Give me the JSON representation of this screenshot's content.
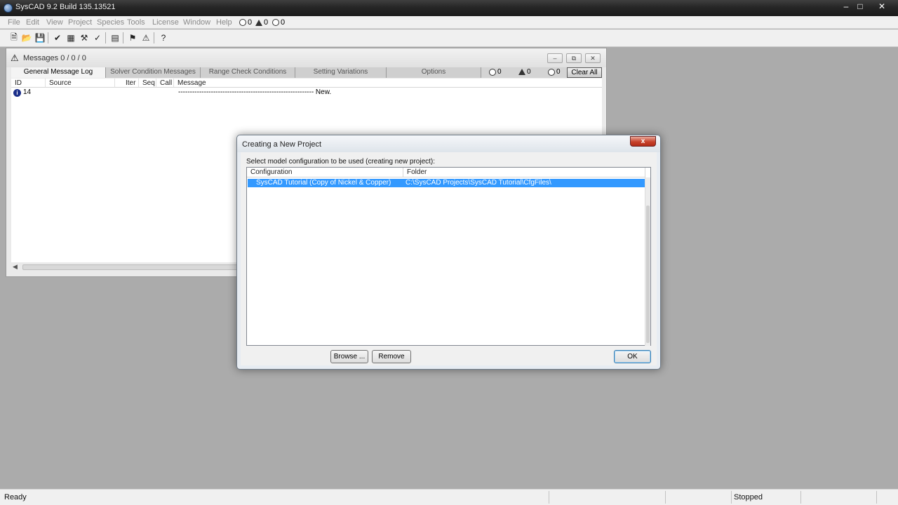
{
  "app": {
    "title": "SysCAD 9.2 Build 135.13521"
  },
  "menu": {
    "items": [
      "File",
      "Edit",
      "View",
      "Project",
      "Species",
      "Tools",
      "License",
      "Window",
      "Help"
    ],
    "counters": [
      "0",
      "0",
      "0"
    ]
  },
  "toolbar": {
    "buttons": [
      "new-file-icon",
      "open-folder-icon",
      "save-icon",
      "check-icon",
      "grid-icon",
      "wrench-check-icon",
      "wand-check-icon",
      "list-icon",
      "key-icon",
      "alert-key-icon",
      "help-icon"
    ]
  },
  "messages_window": {
    "title": "Messages 0 / 0 / 0",
    "tabs": [
      "General Message Log",
      "Solver Condition Messages",
      "Range Check Conditions",
      "Setting Variations",
      "Options"
    ],
    "tab_counters": [
      "0",
      "0",
      "0"
    ],
    "clear_all_label": "Clear All",
    "columns": [
      "ID",
      "Source",
      "Iter",
      "Seq",
      "Call",
      "Message"
    ],
    "rows": [
      {
        "id": "14",
        "message": "---------------------------------------------------------- New."
      }
    ]
  },
  "dialog": {
    "title": "Creating a New Project",
    "close_label": "x",
    "prompt": "Select model configuration to be used (creating new project):",
    "columns": [
      "Configuration",
      "Folder"
    ],
    "rows": [
      {
        "configuration": "SysCAD Tutorial (Copy of Nickel & Copper)",
        "folder": "C:\\SysCAD Projects\\SysCAD Tutorial\\CfgFiles\\"
      }
    ],
    "browse_label": "Browse ...",
    "remove_label": "Remove",
    "ok_label": "OK"
  },
  "statusbar": {
    "left_text": "Ready",
    "state_text": "Stopped"
  }
}
